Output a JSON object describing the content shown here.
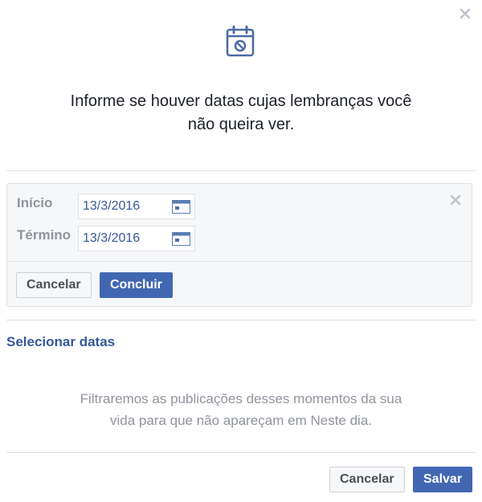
{
  "dialog": {
    "headline_line1": "Informe se houver datas cujas lembranças você",
    "headline_line2": "não queira ver.",
    "header_icon": "calendar-blocked-icon",
    "close_icon": "close-icon"
  },
  "date_panel": {
    "start_label": "Início",
    "start_value": "13/3/2016",
    "end_label": "Término",
    "end_value": "13/3/2016",
    "calendar_icon": "calendar-icon",
    "cancel_label": "Cancelar",
    "done_label": "Concluir"
  },
  "select_dates_link": "Selecionar datas",
  "description_line1": "Filtraremos as publicações desses momentos da sua",
  "description_line2": "vida para que não apareçam em Neste dia.",
  "footer": {
    "cancel_label": "Cancelar",
    "save_label": "Salvar"
  },
  "colors": {
    "primary": "#4267b2",
    "link": "#365899",
    "muted_text": "#90949c",
    "border": "#dddfe2",
    "panel_bg": "#f6f7f9"
  }
}
